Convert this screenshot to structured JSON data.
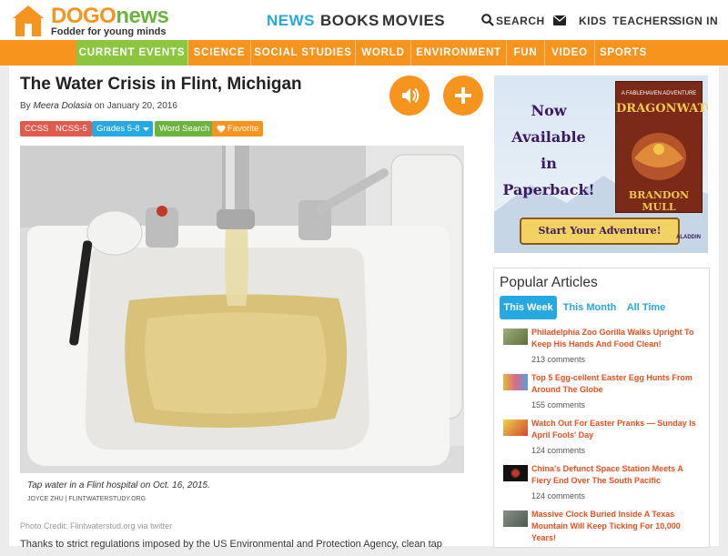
{
  "header": {
    "logo": {
      "brand_dogo": "DOGO",
      "brand_news": "news",
      "tagline": "Fodder for young minds"
    },
    "main_nav": [
      "NEWS",
      "BOOKS",
      "MOVIES"
    ],
    "search_label": "SEARCH",
    "util_nav": [
      "KIDS",
      "TEACHERS",
      "SIGN IN"
    ]
  },
  "categories": [
    "CURRENT EVENTS",
    "SCIENCE",
    "SOCIAL STUDIES",
    "WORLD",
    "ENVIRONMENT",
    "FUN",
    "VIDEO",
    "SPORTS"
  ],
  "article": {
    "title": "The Water Crisis in Flint, Michigan",
    "by": "By",
    "author": "Meera Dolasia",
    "date": "on January 20, 2016",
    "tags": [
      "CCSS",
      "NCSS-5",
      "Grades 5-8",
      "Word Search",
      "Favorite"
    ],
    "image_caption": "Tap water in a Flint hospital on Oct. 16, 2015.",
    "image_credit": "JOYCE ZHU | FLINTWATERSTUDY.ORG",
    "photo_credit": "Photo Credit: Flintwaterstud.org via twitter",
    "body_start": "Thanks to strict regulations imposed by the US Environmental and Protection Agency, clean tap"
  },
  "ad": {
    "lines": [
      "Now",
      "Available",
      "in",
      "Paperback!"
    ],
    "book_series": "A FABLEHAVEN ADVENTURE",
    "book_title": "DRAGONWATCH",
    "book_author": "BRANDON MULL",
    "cta": "Start Your Adventure!",
    "publisher": "ALADDIN"
  },
  "popular": {
    "title": "Popular Articles",
    "tabs": [
      "This Week",
      "This Month",
      "All Time"
    ],
    "items": [
      {
        "title": "Philadelphia Zoo Gorilla Walks Upright To Keep His Hands And Food Clean!",
        "comments": "213 comments"
      },
      {
        "title": "Top 5 Egg-cellent Easter Egg Hunts From Around The Globe",
        "comments": "155 comments"
      },
      {
        "title": "Watch Out For Easter Pranks — Sunday Is April Fools' Day",
        "comments": "124 comments"
      },
      {
        "title": "China's Defunct Space Station Meets A Fiery End Over The South Pacific",
        "comments": "124 comments"
      },
      {
        "title": "Massive Clock Buried Inside A Texas Mountain Will Keep Ticking For 10,000 Years!",
        "comments": ""
      }
    ]
  },
  "colors": {
    "orange": "#f7941d",
    "green": "#8cc63f",
    "blue": "#25a9e0",
    "red": "#e05a4e",
    "link": "#e8501e"
  }
}
